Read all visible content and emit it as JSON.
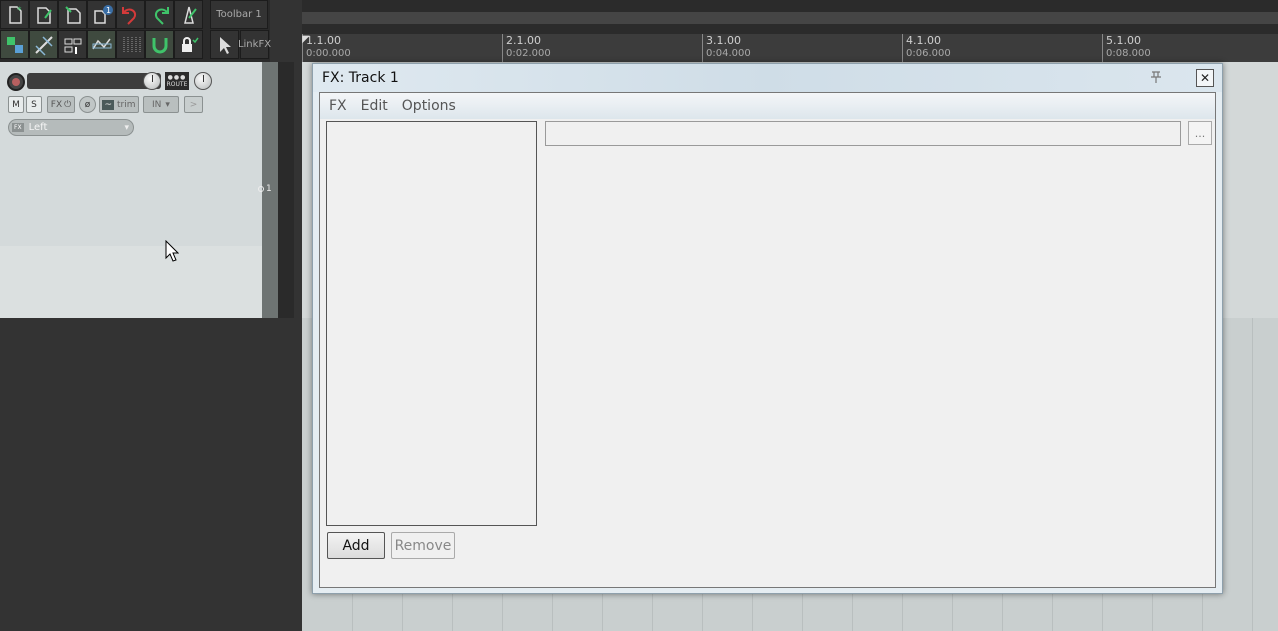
{
  "toolbar": {
    "label": "Toolbar 1",
    "link_fx_line1": "Link",
    "link_fx_line2": "FX",
    "badge_count": "1"
  },
  "track": {
    "route_label": "ROUTE",
    "mute_label": "M",
    "solo_label": "S",
    "fx_label": "FX",
    "trim_label": "trim",
    "input_label": "IN",
    "input_channel": "Left",
    "track_number": "1"
  },
  "ruler": {
    "marks": [
      {
        "bar": "1.1.00",
        "time": "0:00.000"
      },
      {
        "bar": "2.1.00",
        "time": "0:02.000"
      },
      {
        "bar": "3.1.00",
        "time": "0:04.000"
      },
      {
        "bar": "4.1.00",
        "time": "0:06.000"
      },
      {
        "bar": "5.1.00",
        "time": "0:08.000"
      }
    ]
  },
  "fx_window": {
    "title": "FX: Track 1",
    "menu": [
      "FX",
      "Edit",
      "Options"
    ],
    "more_label": "...",
    "add_label": "Add",
    "remove_label": "Remove",
    "name_value": ""
  },
  "colors": {
    "accent_green": "#3fc36a",
    "accent_red": "#d33a3a",
    "track_panel": "#d4dadb",
    "dark_bg": "#333333"
  }
}
